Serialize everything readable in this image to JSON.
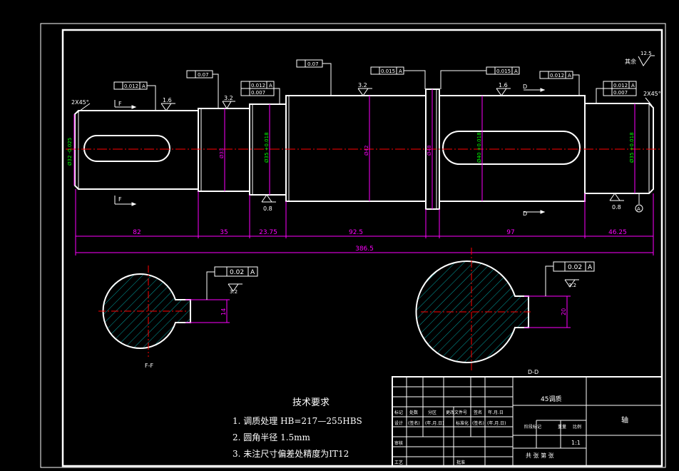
{
  "drawing": {
    "colors": {
      "background": "#000000",
      "outline": "#ffffff",
      "dimension": "#ff00ff",
      "centerline": "#ff0000",
      "hatch": "#00cccc",
      "tolerance_text": "#00ff00"
    },
    "chamfer_left": "2X45°",
    "chamfer_right": "2X45°",
    "roughness_rest_label": "其余",
    "roughness_rest_value": "12.5",
    "roughness": {
      "r1": "1.6",
      "r2": "3.2",
      "r3": "3.2",
      "r4": "1.6",
      "r5": "0.8",
      "r6": "0.8"
    },
    "section_arrow_F": "F",
    "section_arrow_D": "D",
    "datum_label": "A",
    "gdt": {
      "left_runout": "0.012",
      "left_cyl": "0.07",
      "mid_runout": "0.012",
      "mid_cyl": "0.007",
      "center_cyl": "0.07",
      "shoulder_runout_l": "0.015",
      "shoulder_runout_r": "0.015",
      "right_runout": "0.012",
      "end_runout": "0.012",
      "end_cyl": "0.007"
    },
    "diameters": {
      "d1": "Ø32 -0.025",
      "d2": "Ø33",
      "d3": "Ø35 +0.018",
      "d4": "Ø42",
      "d5": "Ø48",
      "d6": "Ø40 +0.018",
      "d7": "Ø35 +0.018"
    },
    "lengths": [
      "82",
      "35",
      "23.75",
      "92.5",
      "97",
      "46.25"
    ],
    "total_length": "386.5",
    "section_ff_label": "F-F",
    "section_dd_label": "D-D",
    "section_ff_gdt": "0.02",
    "section_dd_gdt": "0.02",
    "section_ff_roughness": "3.2",
    "section_dd_roughness": "3.2",
    "section_ff_depth": "14",
    "section_dd_depth": "20"
  },
  "tech_requirements": {
    "title": "技术要求",
    "items": [
      "1. 调质处理 HB=217—255HBS",
      "2. 圆角半径  1.5mm",
      "3. 未注尺寸偏差处精度为IT12"
    ]
  },
  "title_block": {
    "material": "45调质",
    "part_name": "轴",
    "scale": "1:1",
    "sheet": "共 张 第 张",
    "row_labels": [
      "标记",
      "处数",
      "分区",
      "更改文件号",
      "签名",
      "年.月.日"
    ],
    "design_row": [
      "设计",
      "(签名)",
      "(年.月.日)",
      "标准化",
      "(签名)",
      "(年.月.日)"
    ],
    "check": "审核",
    "craft": "工艺",
    "approve": "批准",
    "stage_labels": [
      "阶段标记",
      "重量",
      "比例"
    ]
  }
}
